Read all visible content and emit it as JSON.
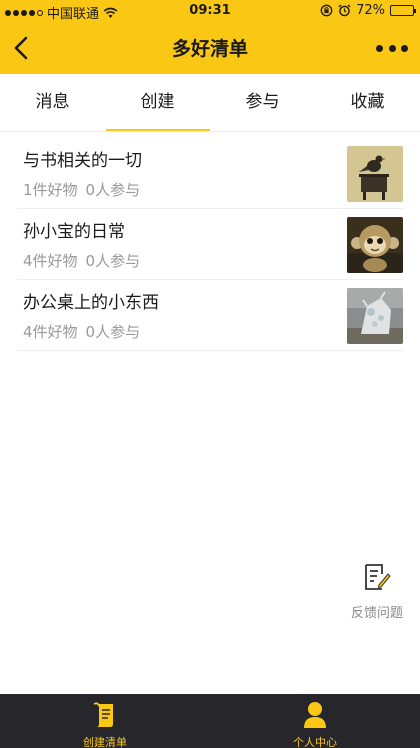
{
  "status_bar": {
    "carrier": "中国联通",
    "time": "09:31",
    "battery": "72%",
    "battery_level": 0.72
  },
  "header": {
    "title": "多好清单"
  },
  "tabs": [
    {
      "label": "消息",
      "active": false
    },
    {
      "label": "创建",
      "active": true
    },
    {
      "label": "参与",
      "active": false
    },
    {
      "label": "收藏",
      "active": false
    }
  ],
  "lists": [
    {
      "name": "与书相关的一切",
      "items": "1件好物",
      "participants": "0人参与",
      "thumb": "bird-sculpture-image"
    },
    {
      "name": "孙小宝的日常",
      "items": "4件好物",
      "participants": "0人参与",
      "thumb": "monkey-figure-image"
    },
    {
      "name": "办公桌上的小东西",
      "items": "4件好物",
      "participants": "0人参与",
      "thumb": "desk-figurine-image"
    }
  ],
  "feedback": {
    "label": "反馈问题",
    "icon": "feedback-edit-icon"
  },
  "tabbar": [
    {
      "label": "创建清单",
      "icon": "scroll-list-icon"
    },
    {
      "label": "个人中心",
      "icon": "person-icon"
    }
  ],
  "colors": {
    "accent": "#fac814",
    "tabbar_bg": "#27272b",
    "meta_text": "#999999"
  }
}
